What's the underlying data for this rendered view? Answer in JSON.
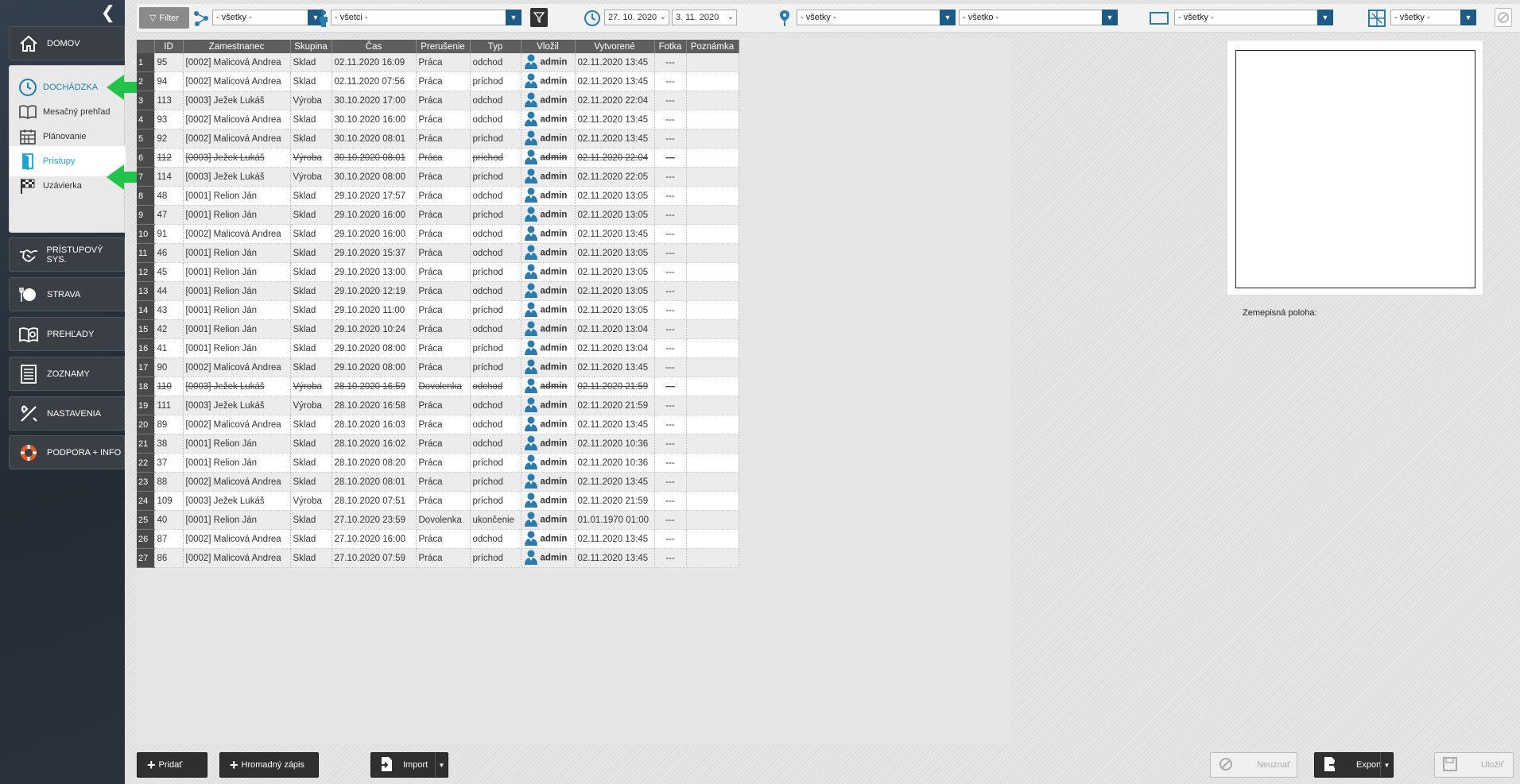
{
  "sidebar": {
    "nav": [
      {
        "label": "DOMOV",
        "icon": "home-icon"
      },
      {
        "label": "PRÍSTUPOVÝ SYS.",
        "icon": "handshake-icon"
      },
      {
        "label": "STRAVA",
        "icon": "plate-icon"
      },
      {
        "label": "PREHĽADY",
        "icon": "reports-icon"
      },
      {
        "label": "ZOZNAMY",
        "icon": "list-icon"
      },
      {
        "label": "NASTAVENIA",
        "icon": "tools-icon"
      },
      {
        "label": "PODPORA + INFO",
        "icon": "lifebuoy-icon"
      }
    ],
    "attendance": {
      "head": "DOCHÁDZKA",
      "items": [
        "Mesačný prehľad",
        "Plánovanie",
        "Prístupy",
        "Uzávierka"
      ]
    }
  },
  "filters": {
    "filter_label": "Filter",
    "group": "- všetky -",
    "person": "- všetci -",
    "date_from": "27. 10. 2020",
    "date_to": "3. 11. 2020",
    "location": "- všetky -",
    "all": "- všetko -",
    "terminal": "- všetky -",
    "map": "- všetky -"
  },
  "table": {
    "headers": [
      "",
      "ID",
      "Zamestnanec",
      "Skupina",
      "Čas",
      "Prerušenie",
      "Typ",
      "Vložil",
      "Vytvorené",
      "Fotka",
      "Poznámka"
    ],
    "rows": [
      [
        "1",
        "95",
        "[0002] Malicová Andrea",
        "Sklad",
        "02.11.2020 16:09",
        "Práca",
        "odchod",
        "admin",
        "02.11.2020 13:45",
        "---",
        ""
      ],
      [
        "2",
        "94",
        "[0002] Malicová Andrea",
        "Sklad",
        "02.11.2020 07:56",
        "Práca",
        "príchod",
        "admin",
        "02.11.2020 13:45",
        "---",
        ""
      ],
      [
        "3",
        "113",
        "[0003] Ježek Lukáš",
        "Výroba",
        "30.10.2020 17:00",
        "Práca",
        "odchod",
        "admin",
        "02.11.2020 22:04",
        "---",
        ""
      ],
      [
        "4",
        "93",
        "[0002] Malicová Andrea",
        "Sklad",
        "30.10.2020 16:00",
        "Práca",
        "odchod",
        "admin",
        "02.11.2020 13:45",
        "---",
        ""
      ],
      [
        "5",
        "92",
        "[0002] Malicová Andrea",
        "Sklad",
        "30.10.2020 08:01",
        "Práca",
        "príchod",
        "admin",
        "02.11.2020 13:45",
        "---",
        ""
      ],
      [
        "6",
        "112",
        "[0003] Ježek Lukáš",
        "Výroba",
        "30.10.2020 08:01",
        "Práca",
        "príchod",
        "admin",
        "02.11.2020 22:04",
        "---",
        ""
      ],
      [
        "7",
        "114",
        "[0003] Ježek Lukáš",
        "Výroba",
        "30.10.2020 08:00",
        "Práca",
        "príchod",
        "admin",
        "02.11.2020 22:05",
        "---",
        ""
      ],
      [
        "8",
        "48",
        "[0001] Relion Ján",
        "Sklad",
        "29.10.2020 17:57",
        "Práca",
        "odchod",
        "admin",
        "02.11.2020 13:05",
        "---",
        ""
      ],
      [
        "9",
        "47",
        "[0001] Relion Ján",
        "Sklad",
        "29.10.2020 16:00",
        "Práca",
        "príchod",
        "admin",
        "02.11.2020 13:05",
        "---",
        ""
      ],
      [
        "10",
        "91",
        "[0002] Malicová Andrea",
        "Sklad",
        "29.10.2020 16:00",
        "Práca",
        "odchod",
        "admin",
        "02.11.2020 13:45",
        "---",
        ""
      ],
      [
        "11",
        "46",
        "[0001] Relion Ján",
        "Sklad",
        "29.10.2020 15:37",
        "Práca",
        "odchod",
        "admin",
        "02.11.2020 13:05",
        "---",
        ""
      ],
      [
        "12",
        "45",
        "[0001] Relion Ján",
        "Sklad",
        "29.10.2020 13:00",
        "Práca",
        "príchod",
        "admin",
        "02.11.2020 13:05",
        "---",
        ""
      ],
      [
        "13",
        "44",
        "[0001] Relion Ján",
        "Sklad",
        "29.10.2020 12:19",
        "Práca",
        "odchod",
        "admin",
        "02.11.2020 13:05",
        "---",
        ""
      ],
      [
        "14",
        "43",
        "[0001] Relion Ján",
        "Sklad",
        "29.10.2020 11:00",
        "Práca",
        "príchod",
        "admin",
        "02.11.2020 13:05",
        "---",
        ""
      ],
      [
        "15",
        "42",
        "[0001] Relion Ján",
        "Sklad",
        "29.10.2020 10:24",
        "Práca",
        "odchod",
        "admin",
        "02.11.2020 13:04",
        "---",
        ""
      ],
      [
        "16",
        "41",
        "[0001] Relion Ján",
        "Sklad",
        "29.10.2020 08:00",
        "Práca",
        "príchod",
        "admin",
        "02.11.2020 13:04",
        "---",
        ""
      ],
      [
        "17",
        "90",
        "[0002] Malicová Andrea",
        "Sklad",
        "29.10.2020 08:00",
        "Práca",
        "príchod",
        "admin",
        "02.11.2020 13:45",
        "---",
        ""
      ],
      [
        "18",
        "110",
        "[0003] Ježek Lukáš",
        "Výroba",
        "28.10.2020 16:59",
        "Dovolenka",
        "odchod",
        "admin",
        "02.11.2020 21:59",
        "---",
        ""
      ],
      [
        "19",
        "111",
        "[0003] Ježek Lukáš",
        "Výroba",
        "28.10.2020 16:58",
        "Práca",
        "odchod",
        "admin",
        "02.11.2020 21:59",
        "---",
        ""
      ],
      [
        "20",
        "89",
        "[0002] Malicová Andrea",
        "Sklad",
        "28.10.2020 16:03",
        "Práca",
        "odchod",
        "admin",
        "02.11.2020 13:45",
        "---",
        ""
      ],
      [
        "21",
        "38",
        "[0001] Relion Ján",
        "Sklad",
        "28.10.2020 16:02",
        "Práca",
        "odchod",
        "admin",
        "02.11.2020 10:36",
        "---",
        ""
      ],
      [
        "22",
        "37",
        "[0001] Relion Ján",
        "Sklad",
        "28.10.2020 08:20",
        "Práca",
        "príchod",
        "admin",
        "02.11.2020 10:36",
        "---",
        ""
      ],
      [
        "23",
        "88",
        "[0002] Malicová Andrea",
        "Sklad",
        "28.10.2020 08:01",
        "Práca",
        "príchod",
        "admin",
        "02.11.2020 13:45",
        "---",
        ""
      ],
      [
        "24",
        "109",
        "[0003] Ježek Lukáš",
        "Výroba",
        "28.10.2020 07:51",
        "Práca",
        "príchod",
        "admin",
        "02.11.2020 21:59",
        "---",
        ""
      ],
      [
        "25",
        "40",
        "[0001] Relion Ján",
        "Sklad",
        "27.10.2020 23:59",
        "Dovolenka",
        "ukončenie",
        "admin",
        "01.01.1970 01:00",
        "---",
        ""
      ],
      [
        "26",
        "87",
        "[0002] Malicová Andrea",
        "Sklad",
        "27.10.2020 16:00",
        "Práca",
        "odchod",
        "admin",
        "02.11.2020 13:45",
        "---",
        ""
      ],
      [
        "27",
        "86",
        "[0002] Malicová Andrea",
        "Sklad",
        "27.10.2020 07:59",
        "Práca",
        "príchod",
        "admin",
        "02.11.2020 13:45",
        "---",
        ""
      ]
    ],
    "deleted_rows": [
      6,
      18
    ]
  },
  "right": {
    "geo_label": "Zemepisná poloha:"
  },
  "buttons": {
    "add": "Pridať",
    "bulk": "Hromadný zápis",
    "import": "Import",
    "reject": "Neuznať",
    "export": "Export",
    "save": "Uložiť"
  },
  "colors": {
    "accent": "#1aa3d9",
    "arrow": "#22c34a",
    "dropdown": "#1c5b86"
  }
}
